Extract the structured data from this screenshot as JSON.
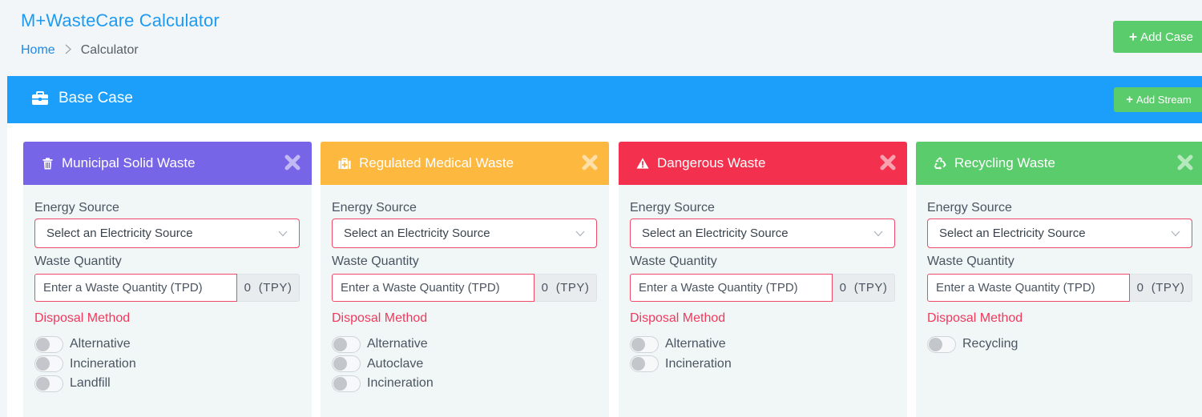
{
  "header": {
    "app_title": "M+WasteCare Calculator",
    "breadcrumb": [
      {
        "label": "Home",
        "link": true
      },
      {
        "label": "Calculator",
        "link": false
      }
    ],
    "breadcrumb_separator": ">",
    "add_case_label": "Add Case"
  },
  "base_case": {
    "title": "Base Case",
    "icon": "briefcase-icon",
    "add_stream_label": "Add Stream",
    "color": "#1b9ffb"
  },
  "streams": [
    {
      "title": "Municipal Solid Waste",
      "icon": "trash-icon",
      "color": "#7765e8",
      "energy_label": "Energy Source",
      "energy_value": "Select an Electricity Source",
      "quantity_label": "Waste Quantity",
      "quantity_placeholder": "Enter a Waste Quantity (TPD)",
      "quantity_addon": "0  (TPY)",
      "disposal_label": "Disposal Method",
      "methods": [
        {
          "label": "Alternative",
          "on": false
        },
        {
          "label": "Incineration",
          "on": false
        },
        {
          "label": "Landfill",
          "on": false
        }
      ]
    },
    {
      "title": "Regulated Medical Waste",
      "icon": "medkit-icon",
      "color": "#fdb83f",
      "energy_label": "Energy Source",
      "energy_value": "Select an Electricity Source",
      "quantity_label": "Waste Quantity",
      "quantity_placeholder": "Enter a Waste Quantity (TPD)",
      "quantity_addon": "0  (TPY)",
      "disposal_label": "Disposal Method",
      "methods": [
        {
          "label": "Alternative",
          "on": false
        },
        {
          "label": "Autoclave",
          "on": false
        },
        {
          "label": "Incineration",
          "on": false
        }
      ]
    },
    {
      "title": "Dangerous Waste",
      "icon": "warning-icon",
      "color": "#f3314f",
      "energy_label": "Energy Source",
      "energy_value": "Select an Electricity Source",
      "quantity_label": "Waste Quantity",
      "quantity_placeholder": "Enter a Waste Quantity (TPD)",
      "quantity_addon": "0  (TPY)",
      "disposal_label": "Disposal Method",
      "methods": [
        {
          "label": "Alternative",
          "on": false
        },
        {
          "label": "Incineration",
          "on": false
        }
      ]
    },
    {
      "title": "Recycling Waste",
      "icon": "recycle-icon",
      "color": "#5bcc6c",
      "energy_label": "Energy Source",
      "energy_value": "Select an Electricity Source",
      "quantity_label": "Waste Quantity",
      "quantity_placeholder": "Enter a Waste Quantity (TPD)",
      "quantity_addon": "0  (TPY)",
      "disposal_label": "Disposal Method",
      "methods": [
        {
          "label": "Recycling",
          "on": false
        }
      ]
    }
  ]
}
